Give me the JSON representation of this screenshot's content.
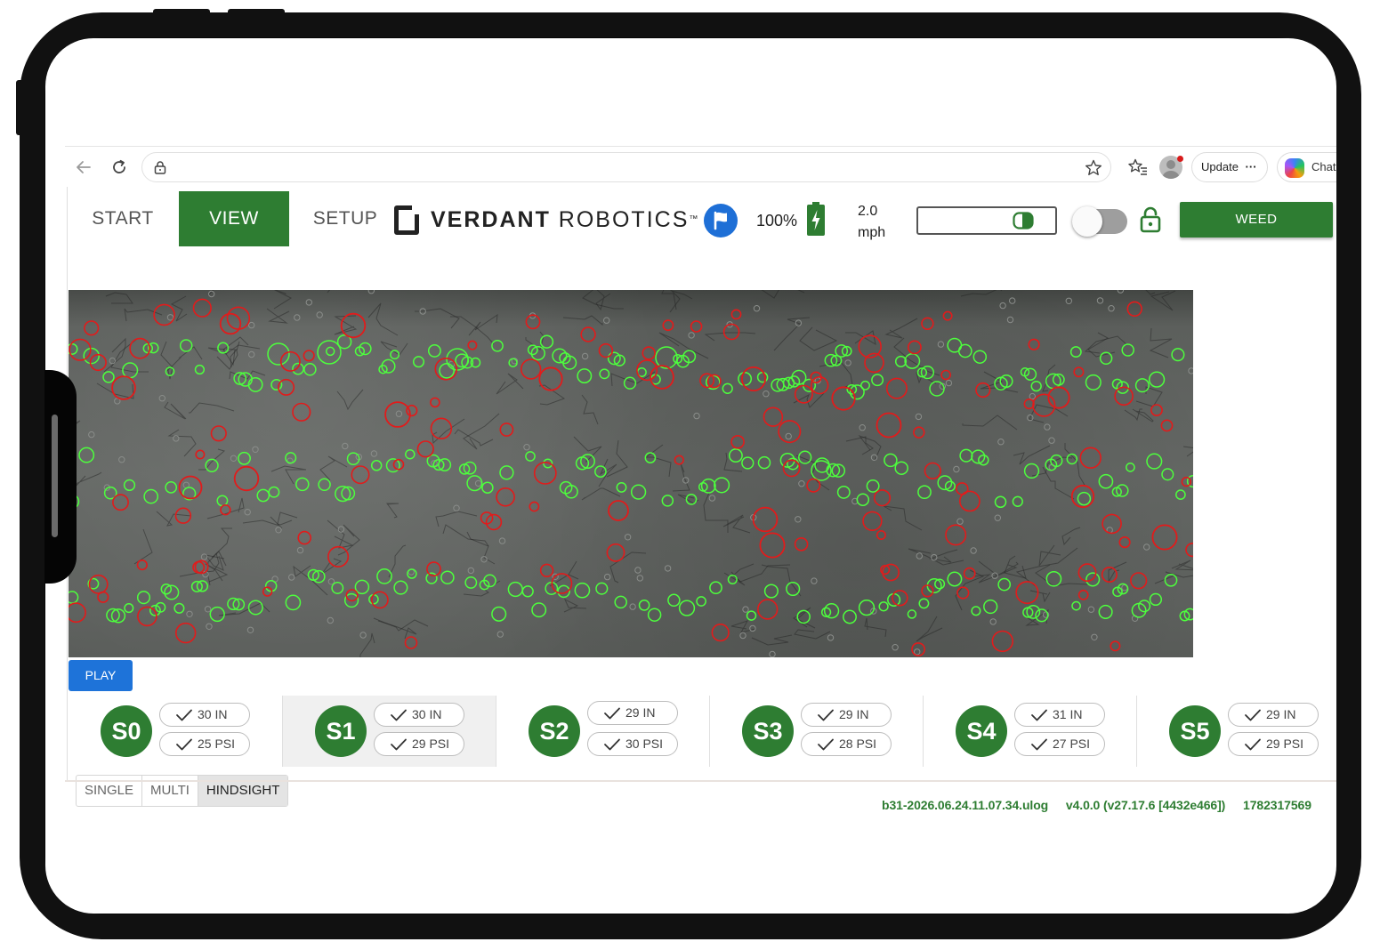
{
  "browser": {
    "update_label": "Update",
    "update_more": "···",
    "chat_label": "Chat"
  },
  "header": {
    "tabs": [
      {
        "label": "START",
        "active": false
      },
      {
        "label": "VIEW",
        "active": true
      },
      {
        "label": "SETUP",
        "active": false
      }
    ],
    "brand_bold": "VERDANT",
    "brand_light": "ROBOTICS",
    "brand_tm": "™",
    "battery_percent": "100%",
    "speed_value": "2.0",
    "speed_unit": "mph",
    "toggle_on": false,
    "weed_label": "WEED",
    "colors": {
      "accent": "#2e7d32",
      "primary_blue": "#1e73d9",
      "badge_blue": "#1e6fd6"
    }
  },
  "camera": {
    "detection_colors": {
      "crop": "#4dff3d",
      "weed": "#e21b1b",
      "marker": "#8a8d8a"
    }
  },
  "controls": {
    "play_label": "PLAY"
  },
  "sensors": [
    {
      "id": "S0",
      "height": "30 IN",
      "pressure": "25 PSI",
      "selected": false
    },
    {
      "id": "S1",
      "height": "30 IN",
      "pressure": "29 PSI",
      "selected": true
    },
    {
      "id": "S2",
      "height": "29 IN",
      "pressure": "30 PSI",
      "selected": false
    },
    {
      "id": "S3",
      "height": "29 IN",
      "pressure": "28 PSI",
      "selected": false
    },
    {
      "id": "S4",
      "height": "31 IN",
      "pressure": "27 PSI",
      "selected": false
    },
    {
      "id": "S5",
      "height": "29 IN",
      "pressure": "29 PSI",
      "selected": false
    }
  ],
  "modes": [
    {
      "label": "SINGLE",
      "active": false
    },
    {
      "label": "MULTI",
      "active": false
    },
    {
      "label": "HINDSIGHT",
      "active": true
    }
  ],
  "footer": {
    "log_file": "b31-2026.06.24.11.07.34.ulog",
    "version": "v4.0.0 (v27.17.6 [4432e466])",
    "timestamp": "1782317569"
  },
  "icons": {
    "back": "back-arrow-icon",
    "reload": "reload-icon",
    "lock": "lock-icon",
    "star": "star-icon",
    "favorites": "favorites-icon",
    "profile": "profile-avatar-icon",
    "copilot": "copilot-icon",
    "flag": "flag-icon",
    "battery": "battery-charging-icon",
    "open_lock": "unlock-icon",
    "check": "check-icon"
  }
}
